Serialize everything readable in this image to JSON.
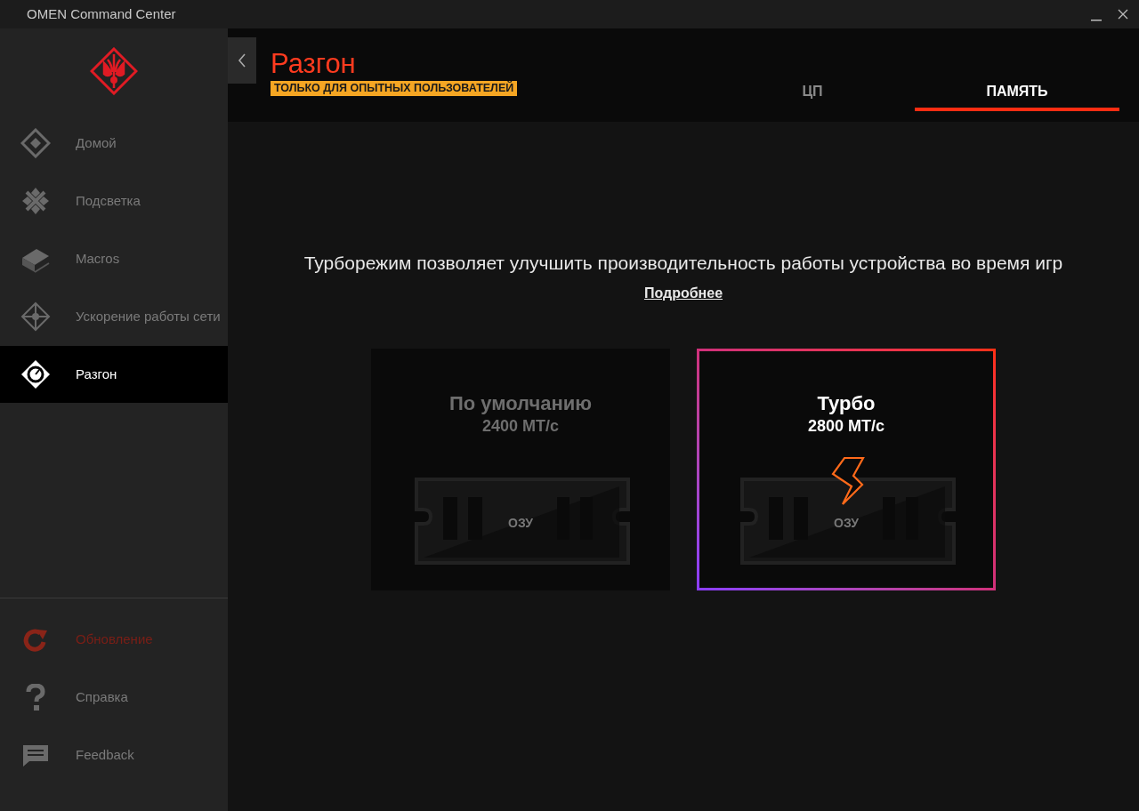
{
  "window": {
    "title": "OMEN Command Center"
  },
  "sidebar": {
    "items": [
      {
        "label": "Домой",
        "selected": false
      },
      {
        "label": "Подсветка",
        "selected": false
      },
      {
        "label": "Macros",
        "selected": false
      },
      {
        "label": "Ускорение работы сети",
        "selected": false
      },
      {
        "label": "Разгон",
        "selected": true
      }
    ],
    "bottom_items": [
      {
        "label": "Обновление",
        "alert": true
      },
      {
        "label": "Справка",
        "alert": false
      },
      {
        "label": "Feedback",
        "alert": false
      }
    ]
  },
  "header": {
    "title": "Разгон",
    "badge": "ТОЛЬКО ДЛЯ ОПЫТНЫХ ПОЛЬЗОВАТЕЛЕЙ"
  },
  "tabs": [
    {
      "label": "ЦП",
      "selected": false
    },
    {
      "label": "ПАМЯТЬ",
      "selected": true
    }
  ],
  "content": {
    "description": "Турборежим позволяет улучшить производительность работы устройства во время игр",
    "link": "Подробнее",
    "modes": [
      {
        "kind": "default",
        "title": "По умолчанию",
        "speed": "2400 МТ/с",
        "chip_label": "ОЗУ",
        "selected": false
      },
      {
        "kind": "turbo",
        "title": "Турбо",
        "speed": "2800 МТ/с",
        "chip_label": "ОЗУ",
        "selected": true
      }
    ]
  }
}
